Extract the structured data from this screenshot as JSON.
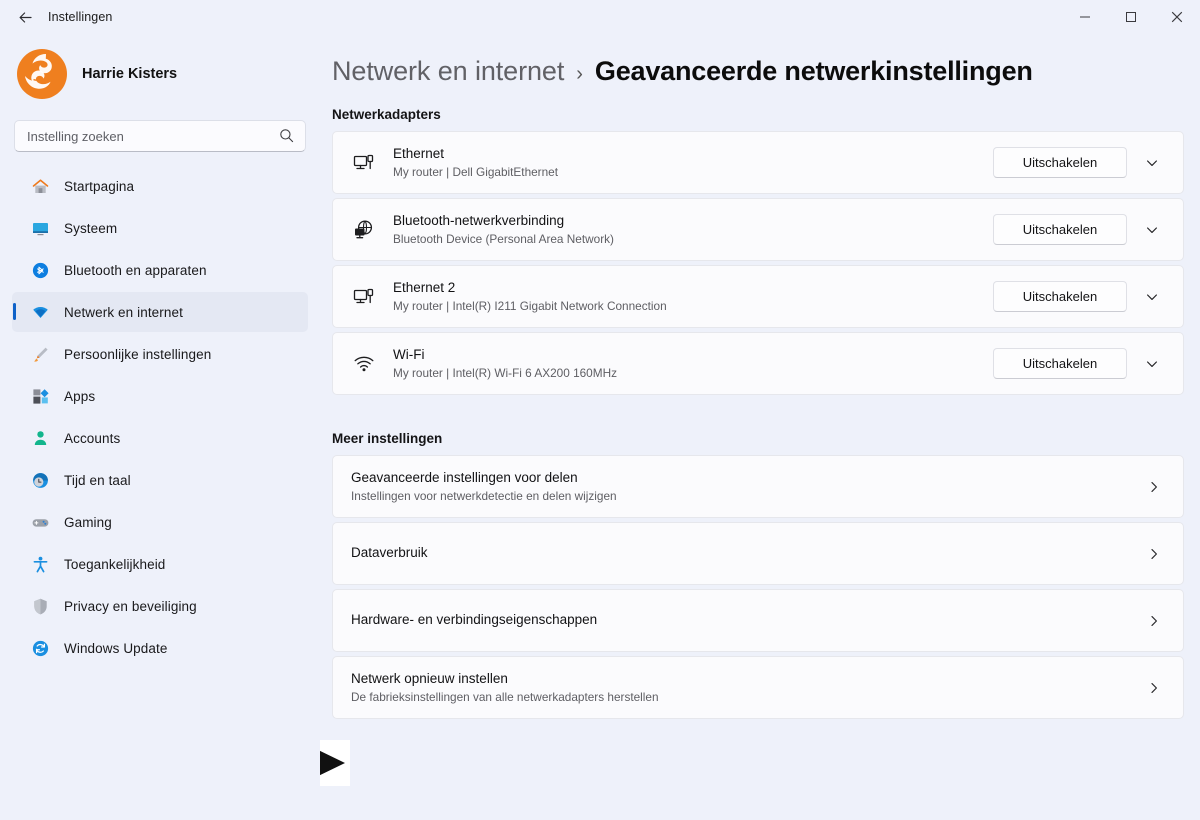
{
  "titlebar": {
    "back_label": "back-arrow",
    "app_title": "Instellingen",
    "minimize": "minimize",
    "maximize": "maximize",
    "close": "close"
  },
  "sidebar": {
    "account_name": "Harrie Kisters",
    "search": {
      "placeholder": "Instelling zoeken",
      "value": ""
    },
    "items": [
      {
        "label": "Startpagina",
        "icon": "home-icon",
        "selected": false
      },
      {
        "label": "Systeem",
        "icon": "system-icon",
        "selected": false
      },
      {
        "label": "Bluetooth en apparaten",
        "icon": "bluetooth-icon",
        "selected": false
      },
      {
        "label": "Netwerk en internet",
        "icon": "network-icon",
        "selected": true
      },
      {
        "label": "Persoonlijke instellingen",
        "icon": "personalization-icon",
        "selected": false
      },
      {
        "label": "Apps",
        "icon": "apps-icon",
        "selected": false
      },
      {
        "label": "Accounts",
        "icon": "accounts-icon",
        "selected": false
      },
      {
        "label": "Tijd en taal",
        "icon": "time-icon",
        "selected": false
      },
      {
        "label": "Gaming",
        "icon": "gaming-icon",
        "selected": false
      },
      {
        "label": "Toegankelijkheid",
        "icon": "accessibility-icon",
        "selected": false
      },
      {
        "label": "Privacy en beveiliging",
        "icon": "privacy-icon",
        "selected": false
      },
      {
        "label": "Windows Update",
        "icon": "update-icon",
        "selected": false
      }
    ]
  },
  "main": {
    "breadcrumb_parent": "Netwerk en internet",
    "breadcrumb_sep": "›",
    "breadcrumb_current": "Geavanceerde netwerkinstellingen",
    "adapters_heading": "Netwerkadapters",
    "adapters": [
      {
        "name": "Ethernet",
        "detail": "My router | Dell GigabitEthernet",
        "icon": "ethernet-icon",
        "action_label": "Uitschakelen"
      },
      {
        "name": "Bluetooth-netwerkverbinding",
        "detail": "Bluetooth Device (Personal Area Network)",
        "icon": "bluetooth-network-icon",
        "action_label": "Uitschakelen"
      },
      {
        "name": "Ethernet 2",
        "detail": "My router | Intel(R) I211 Gigabit Network Connection",
        "icon": "ethernet-icon",
        "action_label": "Uitschakelen"
      },
      {
        "name": "Wi-Fi",
        "detail": "My router | Intel(R) Wi-Fi 6 AX200 160MHz",
        "icon": "wifi-icon",
        "action_label": "Uitschakelen"
      }
    ],
    "more_heading": "Meer instellingen",
    "more_items": [
      {
        "title": "Geavanceerde instellingen voor delen",
        "subtitle": "Instellingen voor netwerkdetectie en delen wijzigen"
      },
      {
        "title": "Dataverbruik",
        "subtitle": ""
      },
      {
        "title": "Hardware- en verbindingseigenschappen",
        "subtitle": ""
      },
      {
        "title": "Netwerk opnieuw instellen",
        "subtitle": "De fabrieksinstellingen van alle netwerkadapters herstellen"
      }
    ]
  },
  "annotation": {
    "name": "pointing-arrow",
    "target": "Netwerk opnieuw instellen"
  },
  "colors": {
    "page_background": "#eef1fa",
    "card_background": "#fbfbfd",
    "accent": "#0f62c8",
    "selected_item_background": "#e4e8f3",
    "avatar_orange": "#ef7f1f"
  }
}
